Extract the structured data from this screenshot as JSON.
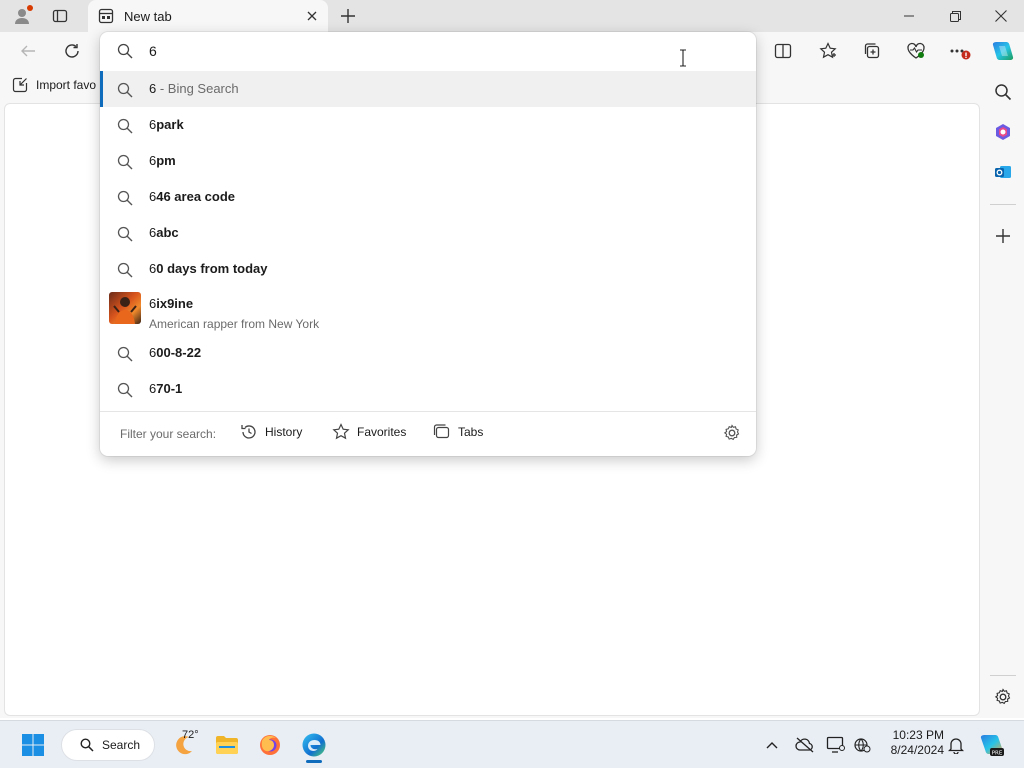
{
  "browser": {
    "tab": {
      "label": "New tab"
    },
    "favorites_bar": {
      "import_label": "Import favo"
    }
  },
  "omnibox": {
    "input_value": "6",
    "suggestions": [
      {
        "prefix": "6",
        "bold": "",
        "suffix": " - Bing Search",
        "icon": "search-icon",
        "selected": true
      },
      {
        "prefix": "6",
        "bold": "park",
        "icon": "search-icon"
      },
      {
        "prefix": "6",
        "bold": "pm",
        "icon": "search-icon"
      },
      {
        "prefix": "6",
        "bold": "46 area code",
        "icon": "search-icon"
      },
      {
        "prefix": "6",
        "bold": "abc",
        "icon": "search-icon"
      },
      {
        "prefix": "6",
        "bold": "0 days from today",
        "icon": "search-icon"
      },
      {
        "prefix": "6",
        "bold": "ix9ine",
        "description": "American rapper from New York",
        "icon": "entity-thumbnail"
      },
      {
        "prefix": "6",
        "bold": "00-8-22",
        "icon": "search-icon"
      },
      {
        "prefix": "6",
        "bold": "70-1",
        "icon": "search-icon"
      }
    ],
    "filter": {
      "label": "Filter your search:",
      "history": "History",
      "favorites": "Favorites",
      "tabs": "Tabs"
    }
  },
  "taskbar": {
    "search_label": "Search",
    "weather_temp": "72°",
    "time": "10:23 PM",
    "date": "8/24/2024"
  },
  "colors": {
    "accent": "#0f6cbd",
    "notification_badge": "#c42b1c"
  }
}
